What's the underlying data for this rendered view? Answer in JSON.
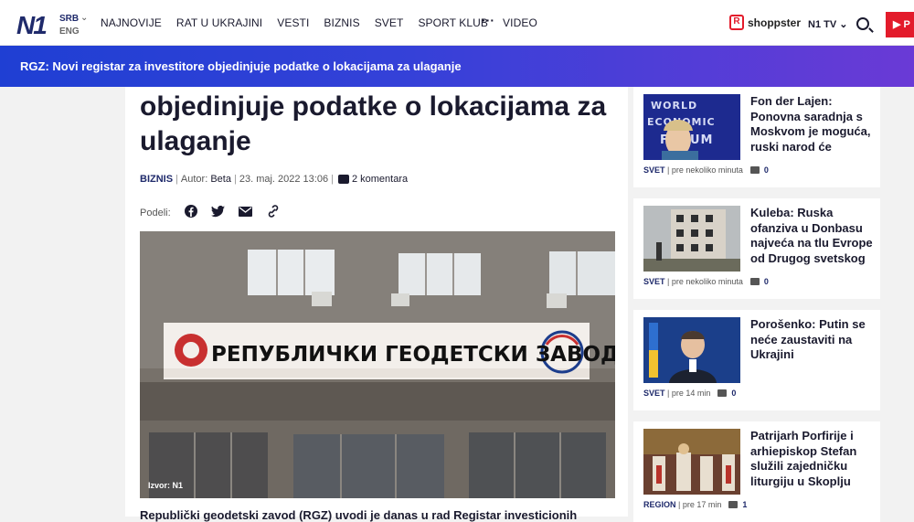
{
  "header": {
    "logo": "N1",
    "lang_primary": "SRB",
    "lang_secondary": "ENG",
    "nav": [
      "NAJNOVIJE",
      "RAT U UKRAJINI",
      "VESTI",
      "BIZNIS",
      "SVET",
      "SPORT KLUB",
      "VIDEO"
    ],
    "more": "···",
    "shop_label": "shoppster",
    "tv_label": "N1 TV",
    "red_button": "P"
  },
  "breaking": {
    "text": "RGZ: Novi registar za investitore objedinjuje podatke o lokacijama za ulaganje"
  },
  "article": {
    "headline": "objedinjuje podatke o lokacijama za ulaganje",
    "category": "BIZNIS",
    "author_label": "Autor:",
    "author": "Beta",
    "date": "23. maj. 2022 13:06",
    "comments": "2 komentara",
    "share_label": "Podeli:",
    "photo_caption": "Izvor: N1",
    "sign_text": "РЕПУБЛИЧКИ ГЕОДЕТСКИ ЗАВОД",
    "lede": "Republički geodetski zavod (RGZ) uvodi je danas u rad Registar investicionih"
  },
  "sidebar": [
    {
      "title": "Fon der Lajen: Ponovna saradnja s Moskvom je moguća, ruski narod će",
      "category": "SVET",
      "time": "pre nekoliko minuta",
      "comments": "0",
      "thumb_text": "WORLD ECONOMIC FORUM"
    },
    {
      "title": "Kuleba: Ruska ofanziva u Donbasu najveća na tlu Evrope od Drugog svetskog",
      "category": "SVET",
      "time": "pre nekoliko minuta",
      "comments": "0"
    },
    {
      "title": "Porošenko: Putin se neće zaustaviti na Ukrajini",
      "category": "SVET",
      "time": "pre 14 min",
      "comments": "0"
    },
    {
      "title": "Patrijarh Porfirije i arhiepiskop Stefan služili zajedničku liturgiju u Skoplju",
      "category": "REGION",
      "time": "pre 17 min",
      "comments": "1"
    }
  ]
}
